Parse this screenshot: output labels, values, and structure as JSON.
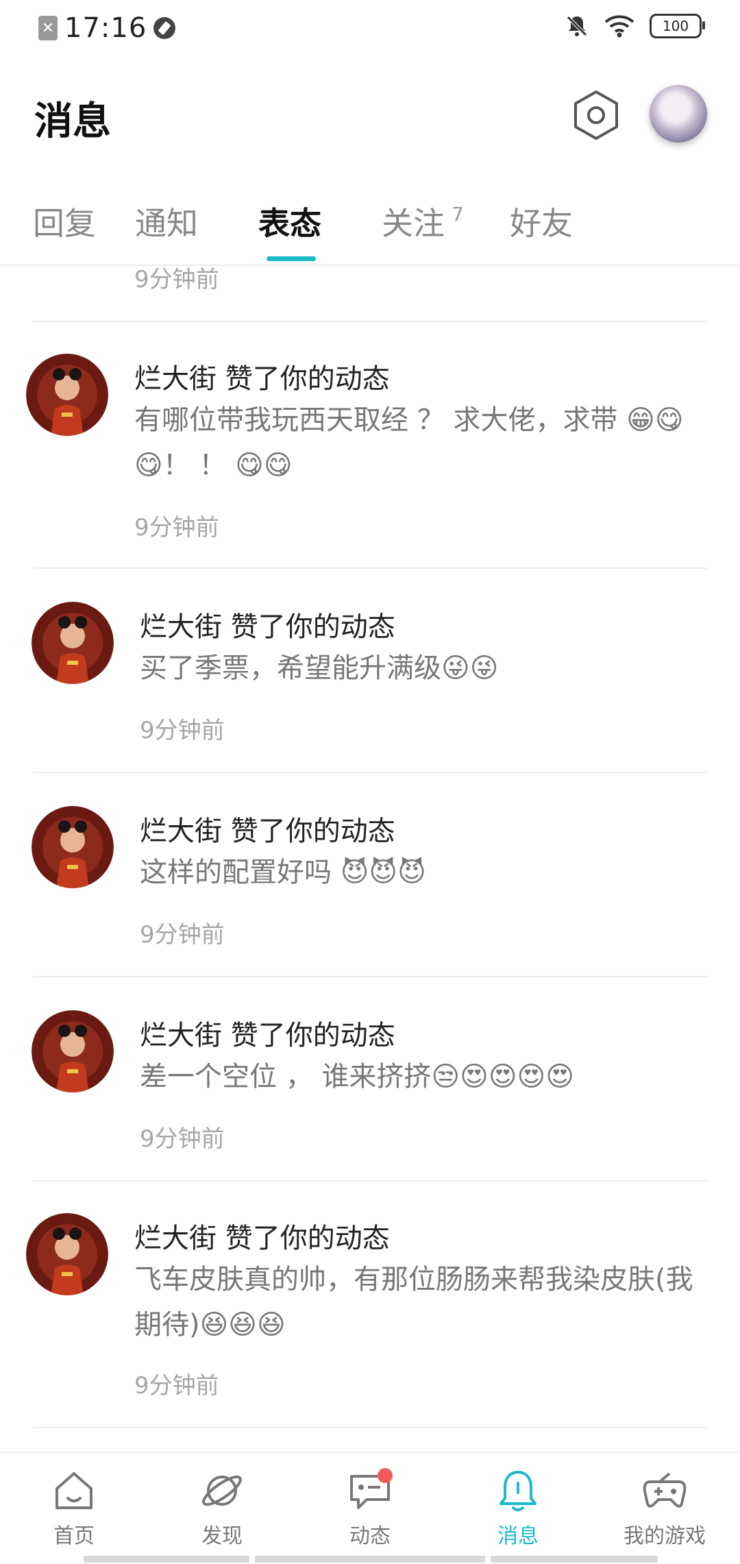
{
  "status_bar": {
    "time": "17:16",
    "battery": "100"
  },
  "header": {
    "title": "消息"
  },
  "tabs": [
    {
      "label": "回复"
    },
    {
      "label": "通知"
    },
    {
      "label": "表态",
      "active": true
    },
    {
      "label": "关注",
      "count": "7"
    },
    {
      "label": "好友"
    }
  ],
  "partial_item": {
    "time": "9分钟前"
  },
  "items": [
    {
      "title": "烂大街 赞了你的动态",
      "content": "有哪位带我玩西天取经 ？ 求大佬，求带 😁😋😋！ ！ 😋😋",
      "time": "9分钟前"
    },
    {
      "title": "烂大街 赞了你的动态",
      "content": "买了季票，希望能升满级😜😜",
      "time": "9分钟前"
    },
    {
      "title": "烂大街 赞了你的动态",
      "content": "这样的配置好吗 😈😈😈",
      "time": "9分钟前"
    },
    {
      "title": "烂大街 赞了你的动态",
      "content": "差一个空位 ， 谁来挤挤😒😍😍😍😍",
      "time": "9分钟前"
    },
    {
      "title": "烂大街 赞了你的动态",
      "content": "飞车皮肤真的帅，有那位肠肠来帮我染皮肤(我期待)😆😆😆",
      "time": "9分钟前"
    }
  ],
  "bottom_nav": [
    {
      "label": "首页",
      "icon": "home-icon"
    },
    {
      "label": "发现",
      "icon": "planet-icon"
    },
    {
      "label": "动态",
      "icon": "chat-icon",
      "badge": true
    },
    {
      "label": "消息",
      "icon": "bell-icon",
      "active": true
    },
    {
      "label": "我的游戏",
      "icon": "gamepad-icon"
    }
  ],
  "colors": {
    "accent": "#1bbac8",
    "badge": "#f05a5a"
  }
}
